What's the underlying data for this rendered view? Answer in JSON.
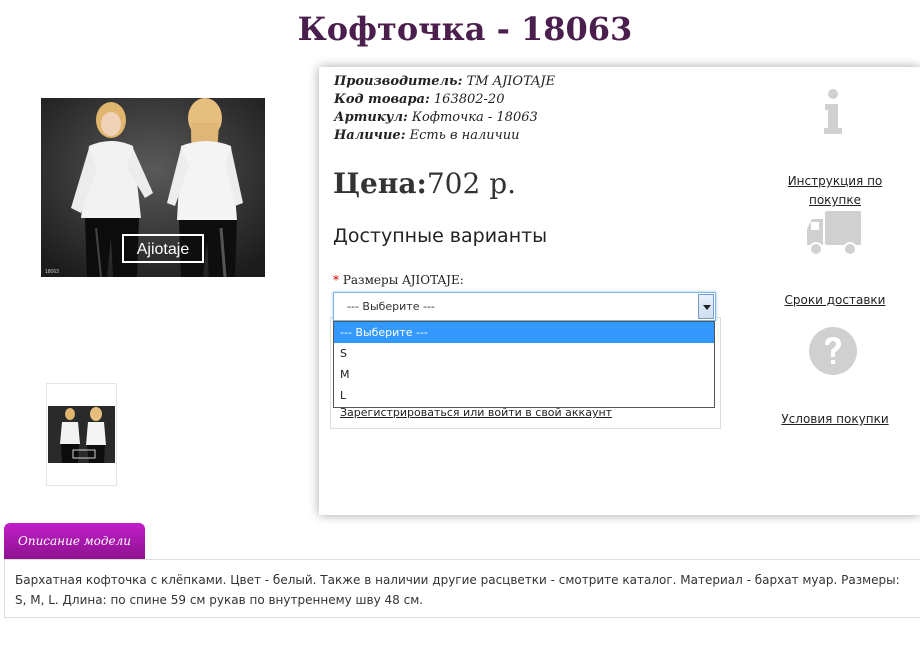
{
  "product": {
    "title": "Кофточка - 18063",
    "photo_brand_watermark": "Ajiotaje",
    "photo_code": "18063",
    "manufacturer_label": "Производитель:",
    "manufacturer_value": "ТМ AJIOTAJE",
    "code_label": "Код товара:",
    "code_value": "163802-20",
    "article_label": "Артикул:",
    "article_value": "Кофточка - 18063",
    "availability_label": "Наличие:",
    "availability_value": "Есть в наличии",
    "price_label": "Цена:",
    "price_value": "702 р."
  },
  "options": {
    "heading": "Доступные варианты",
    "required_mark": "*",
    "size_label": "Размеры AJIOTAJE:",
    "selected": "--- Выберите ---",
    "items": [
      "--- Выберите ---",
      "S",
      "M",
      "L"
    ],
    "login_link": "Зарегистрироваться или войти в свой аккаунт"
  },
  "sidebar": {
    "instruction_link": "Инструкция по покупке",
    "delivery_link": "Сроки доставки",
    "terms_link": "Условия покупки"
  },
  "tabs": {
    "description_tab": "Описание модели",
    "description_text": "Бархатная кофточка с клёпками. Цвет - белый. Также в наличии другие расцветки - смотрите каталог. Материал - бархат муар. Размеры: S, M, L. Длина: по спине 59 см рукав по внутреннему шву 48 см."
  },
  "colors": {
    "title": "#4a1f4d",
    "tab_accent": "#a818ad",
    "selected_option": "#3399ff",
    "icon_gray": "#cccccc"
  },
  "icons": [
    "info-icon",
    "truck-icon",
    "question-icon",
    "dropdown-arrow-icon"
  ]
}
